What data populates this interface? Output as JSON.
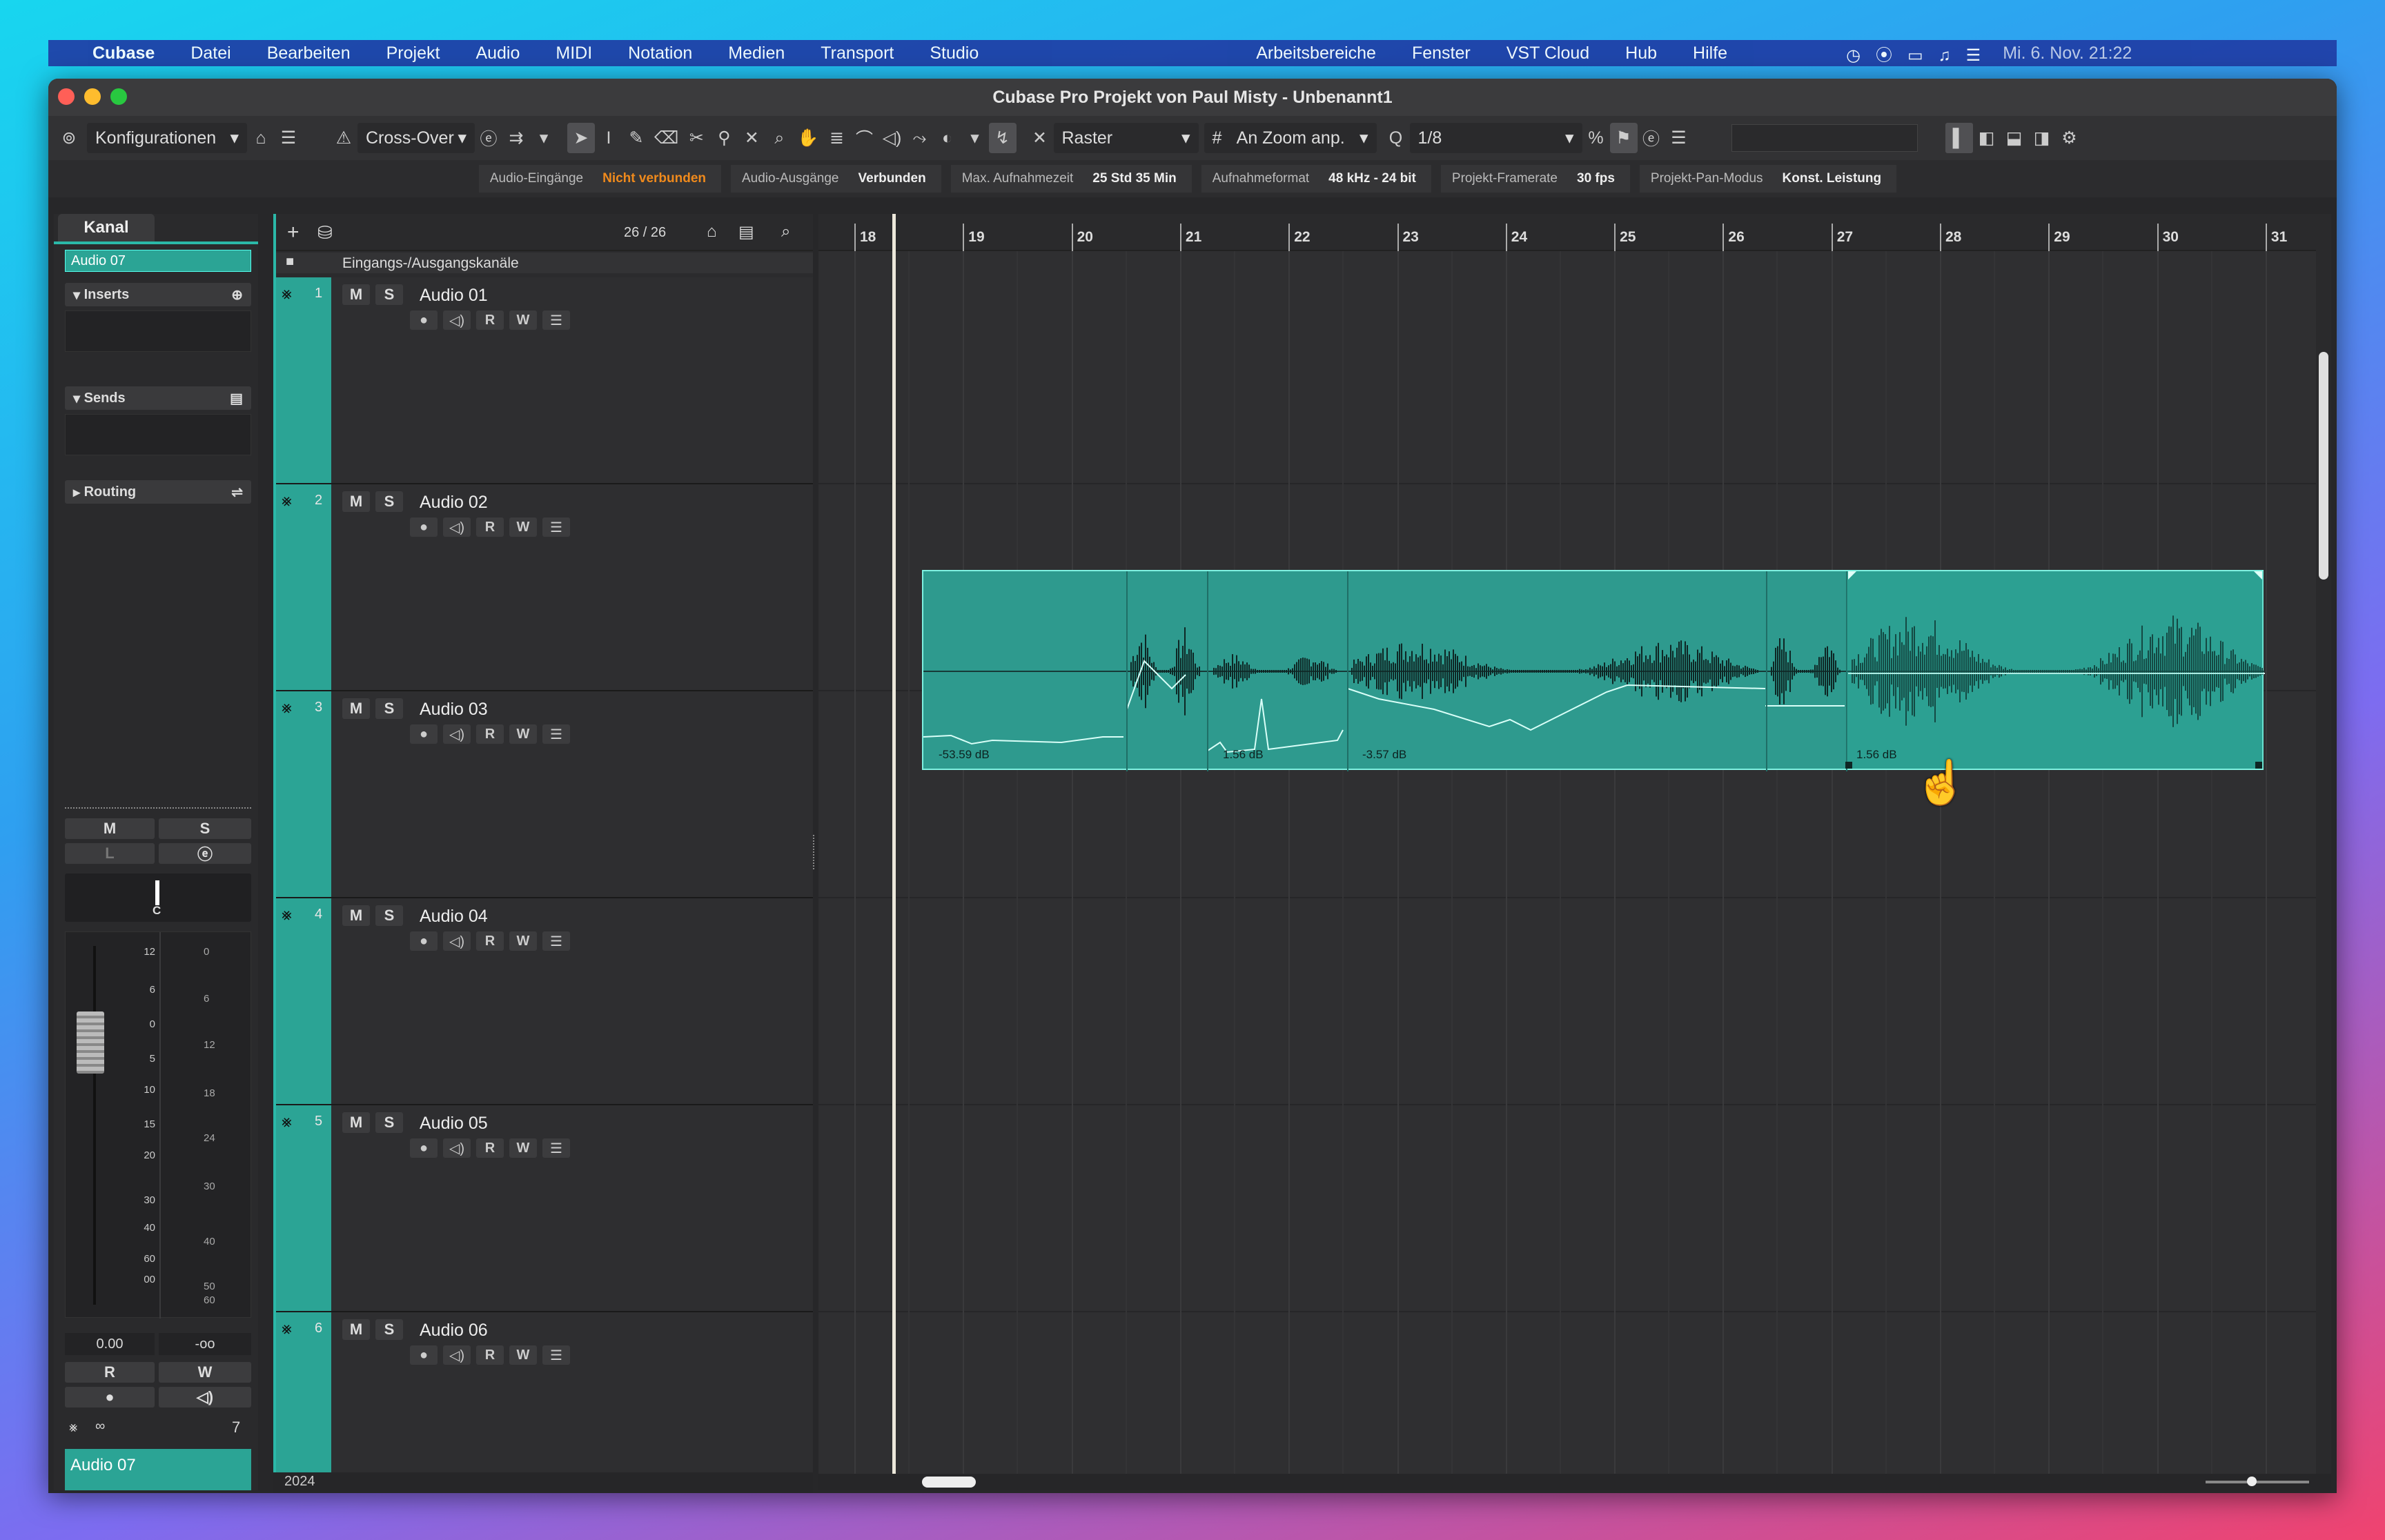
{
  "menubar": {
    "app": "Cubase",
    "items": [
      "Datei",
      "Bearbeiten",
      "Projekt",
      "Audio",
      "MIDI",
      "Notation",
      "Medien",
      "Transport",
      "Studio"
    ],
    "right_items": [
      "Arbeitsbereiche",
      "Fenster",
      "VST Cloud",
      "Hub",
      "Hilfe"
    ],
    "clock": "Mi. 6. Nov.  21:22"
  },
  "window": {
    "title": "Cubase Pro Projekt von Paul Misty - Unbenannt1"
  },
  "toolbar": {
    "konfig": "Konfigurationen",
    "crossover": "Cross-Over",
    "snap_mode": "Raster",
    "grid": "An Zoom anp.",
    "quantize": "1/8"
  },
  "status": [
    {
      "k": "Audio-Eingänge",
      "v": "Nicht verbunden",
      "warn": true
    },
    {
      "k": "Audio-Ausgänge",
      "v": "Verbunden"
    },
    {
      "k": "Max. Aufnahmezeit",
      "v": "25 Std 35 Min"
    },
    {
      "k": "Aufnahmeformat",
      "v": "48 kHz - 24 bit"
    },
    {
      "k": "Projekt-Framerate",
      "v": "30 fps"
    },
    {
      "k": "Projekt-Pan-Modus",
      "v": "Konst. Leistung"
    }
  ],
  "inspector": {
    "tab": "Kanal",
    "channel": "Audio 07",
    "inserts": "Inserts",
    "sends": "Sends",
    "routing": "Routing",
    "m": "M",
    "s": "S",
    "l": "L",
    "pan": "C",
    "volume": "0.00",
    "peak": "-oo",
    "r": "R",
    "w": "W",
    "count": "7",
    "footer": "Audio 07",
    "scale_left": [
      "12",
      "6",
      "0",
      "5",
      "10",
      "15",
      "20",
      "30",
      "40",
      "60",
      "00"
    ],
    "scale_right": [
      "0",
      "6",
      "12",
      "18",
      "24",
      "30",
      "40",
      "50",
      "60"
    ]
  },
  "tracklist": {
    "counter": "26 / 26",
    "folder": "Eingangs-/Ausgangskanäle",
    "year": "2024",
    "tracks": [
      {
        "num": "1",
        "name": "Audio 01"
      },
      {
        "num": "2",
        "name": "Audio 02"
      },
      {
        "num": "3",
        "name": "Audio 03"
      },
      {
        "num": "4",
        "name": "Audio 04"
      },
      {
        "num": "5",
        "name": "Audio 05"
      },
      {
        "num": "6",
        "name": "Audio 06"
      }
    ]
  },
  "ruler": [
    "18",
    "19",
    "20",
    "21",
    "22",
    "23",
    "24",
    "25",
    "26",
    "27",
    "28",
    "29",
    "30",
    "31"
  ],
  "events": {
    "gain_labels": [
      "-53.59 dB",
      "1.56 dB",
      "-3.57 dB",
      "1.56 dB"
    ]
  },
  "colors": {
    "accent": "#2ba495",
    "event": "#2e9a8e",
    "warn": "#f08a1c"
  }
}
